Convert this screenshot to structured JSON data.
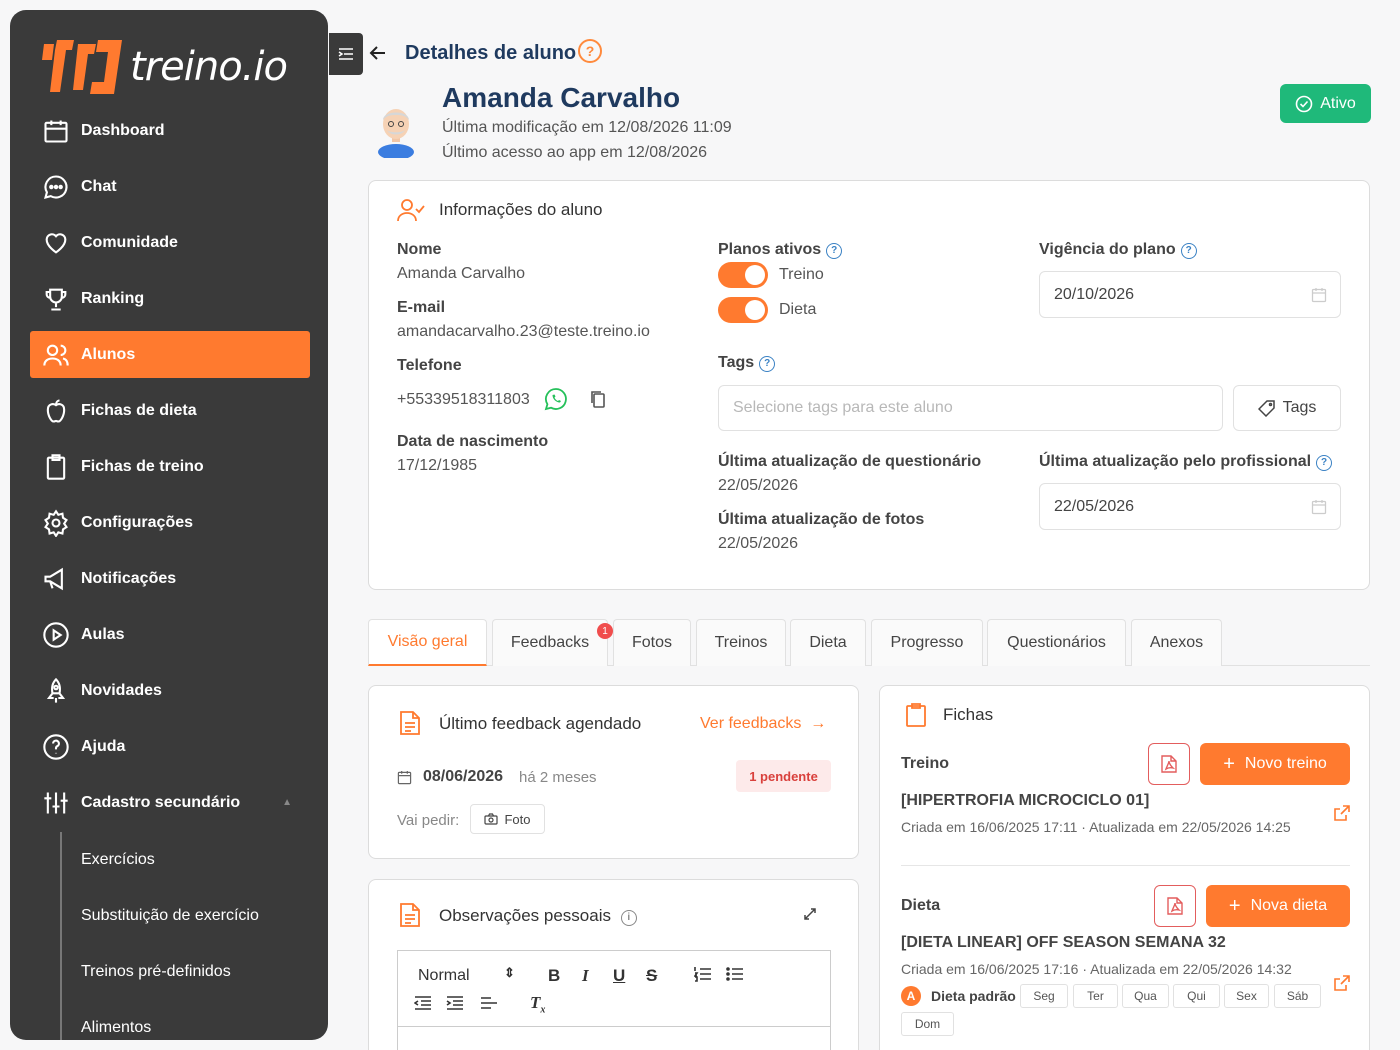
{
  "app": {
    "logo_text": "treino.io",
    "accent": "#ff7a2f",
    "sidebar_bg": "#3a3a3a"
  },
  "sidebar": {
    "items": [
      {
        "label": "Dashboard",
        "icon": "calendar-icon"
      },
      {
        "label": "Chat",
        "icon": "chat-bubble-icon"
      },
      {
        "label": "Comunidade",
        "icon": "heart-icon"
      },
      {
        "label": "Ranking",
        "icon": "trophy-icon"
      },
      {
        "label": "Alunos",
        "icon": "users-icon",
        "active": true
      },
      {
        "label": "Fichas de dieta",
        "icon": "apple-icon"
      },
      {
        "label": "Fichas de treino",
        "icon": "clipboard-icon"
      },
      {
        "label": "Configurações",
        "icon": "gear-icon"
      },
      {
        "label": "Notificações",
        "icon": "megaphone-icon"
      },
      {
        "label": "Aulas",
        "icon": "play-circle-icon"
      },
      {
        "label": "Novidades",
        "icon": "rocket-icon"
      },
      {
        "label": "Ajuda",
        "icon": "question-circle-icon"
      },
      {
        "label": "Cadastro secundário",
        "icon": "sliders-icon"
      }
    ],
    "sub_items": [
      "Exercícios",
      "Substituição de exercício",
      "Treinos pré-definidos",
      "Alimentos"
    ]
  },
  "header": {
    "title": "Detalhes de aluno",
    "help": "?"
  },
  "student": {
    "name": "Amanda Carvalho",
    "last_modified": "Última modificação em 12/08/2026 11:09",
    "last_access": "Último acesso ao app em 12/08/2026",
    "status": "Ativo",
    "status_color": "#1fb97a"
  },
  "info": {
    "title": "Informações do aluno",
    "name_label": "Nome",
    "name_value": "Amanda Carvalho",
    "email_label": "E-mail",
    "email_value": "amandacarvalho.23@teste.treino.io",
    "phone_label": "Telefone",
    "phone_value": "+55339518311803",
    "birth_label": "Data de nascimento",
    "birth_value": "17/12/1985",
    "plans_label": "Planos ativos",
    "plan1": "Treino",
    "plan2": "Dieta",
    "validity_label": "Vigência do plano",
    "validity_value": "20/10/2026",
    "tags_label": "Tags",
    "tags_placeholder": "Selecione tags para este aluno",
    "tags_button": "Tags",
    "quest_label": "Última atualização de questionário",
    "quest_value": "22/05/2026",
    "photos_label": "Última atualização de fotos",
    "photos_value": "22/05/2026",
    "prof_label": "Última atualização pelo profissional",
    "prof_value": "22/05/2026"
  },
  "tabs": [
    {
      "label": "Visão geral",
      "active": true
    },
    {
      "label": "Feedbacks",
      "badge": "1"
    },
    {
      "label": "Fotos"
    },
    {
      "label": "Treinos"
    },
    {
      "label": "Dieta"
    },
    {
      "label": "Progresso"
    },
    {
      "label": "Questionários"
    },
    {
      "label": "Anexos"
    }
  ],
  "feedback": {
    "title": "Último feedback agendado",
    "link": "Ver feedbacks",
    "date": "08/06/2026",
    "relative": "há 2 meses",
    "pending": "1 pendente",
    "ask_label": "Vai pedir:",
    "ask_chip": "Foto"
  },
  "observations": {
    "title": "Observações pessoais",
    "format_select": "Normal"
  },
  "fichas": {
    "title": "Fichas",
    "treino_label": "Treino",
    "new_treino": "Novo treino",
    "treino_name": "[HIPERTROFIA MICROCICLO 01]",
    "treino_meta": "Criada em 16/06/2025 17:11 · Atualizada em 22/05/2026 14:25",
    "dieta_label": "Dieta",
    "new_dieta": "Nova dieta",
    "dieta_name": "[DIETA LINEAR] OFF SEASON SEMANA 32",
    "dieta_meta": "Criada em 16/06/2025 17:16 · Atualizada em 22/05/2026 14:32",
    "dieta_badge": "A",
    "dieta_default": "Dieta padrão",
    "days": [
      "Seg",
      "Ter",
      "Qua",
      "Qui",
      "Sex",
      "Sáb",
      "Dom"
    ]
  }
}
